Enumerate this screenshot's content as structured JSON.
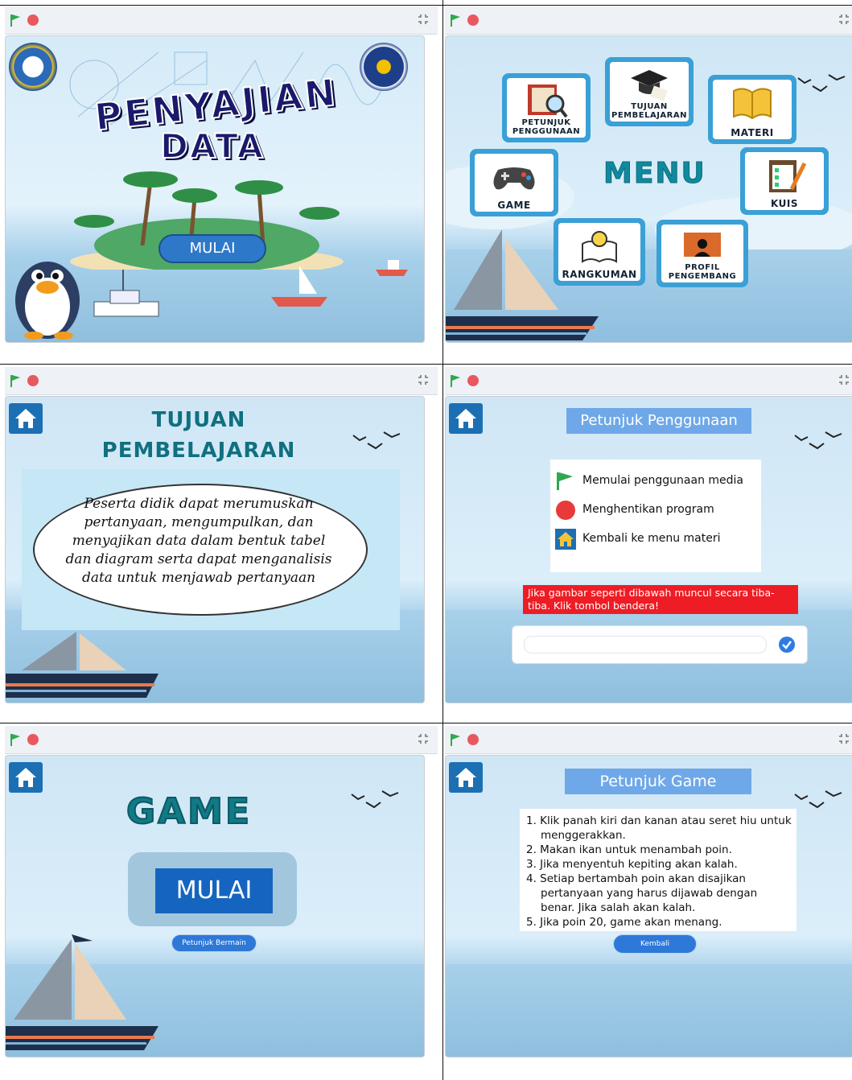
{
  "panels": {
    "title": {
      "word1": "PENYAJIAN",
      "word2": "DATA",
      "start_button": "MULAI"
    },
    "menu": {
      "title": "MENU",
      "buttons": [
        {
          "label": "PETUNJUK\nPENGGUNAAN",
          "icon": "guide-book-icon"
        },
        {
          "label": "TUJUAN\nPEMBELAJARAN",
          "icon": "graduation-cap-icon"
        },
        {
          "label": "MATERI",
          "icon": "open-book-icon"
        },
        {
          "label": "GAME",
          "icon": "gamepad-icon"
        },
        {
          "label": "KUIS",
          "icon": "clipboard-icon"
        },
        {
          "label": "RANGKUMAN",
          "icon": "lightbulb-book-icon"
        },
        {
          "label": "PROFIL\nPENGEMBANG",
          "icon": "presenter-icon"
        }
      ]
    },
    "tujuan": {
      "title_line1": "TUJUAN",
      "title_line2": "PEMBELAJARAN",
      "body": "Peserta didik dapat merumuskan pertanyaan, mengumpulkan, dan menyajikan data dalam bentuk tabel dan diagram serta dapat menganalisis data untuk menjawab pertanyaan"
    },
    "petunjuk": {
      "title": "Petunjuk Penggunaan",
      "items": [
        {
          "icon": "green-flag-icon",
          "text": "Memulai penggunaan media"
        },
        {
          "icon": "stop-octagon-icon",
          "text": "Menghentikan program"
        },
        {
          "icon": "home-icon",
          "text": "Kembali ke menu materi"
        }
      ],
      "note": "Jika gambar seperti dibawah muncul secara tiba-tiba. Klik tombol bendera!"
    },
    "game": {
      "title": "GAME",
      "start_button": "MULAI",
      "help_button": "Petunjuk Bermain"
    },
    "petunjuk_game": {
      "title": "Petunjuk Game",
      "steps": [
        "1. Klik panah kiri dan kanan atau seret hiu untuk menggerakkan.",
        "2. Makan ikan untuk menambah poin.",
        "3. Jika menyentuh kepiting akan kalah.",
        "4. Setiap bertambah poin akan disajikan pertanyaan yang harus dijawab dengan benar. Jika salah akan kalah.",
        "5. Jika poin 20, game akan menang."
      ],
      "back_button": "Kembali"
    }
  },
  "colors": {
    "accent": "#1d6fb3",
    "teal": "#10707f",
    "stop": "#e8595f",
    "flag": "#2fa84f",
    "note": "#ee1c24"
  }
}
